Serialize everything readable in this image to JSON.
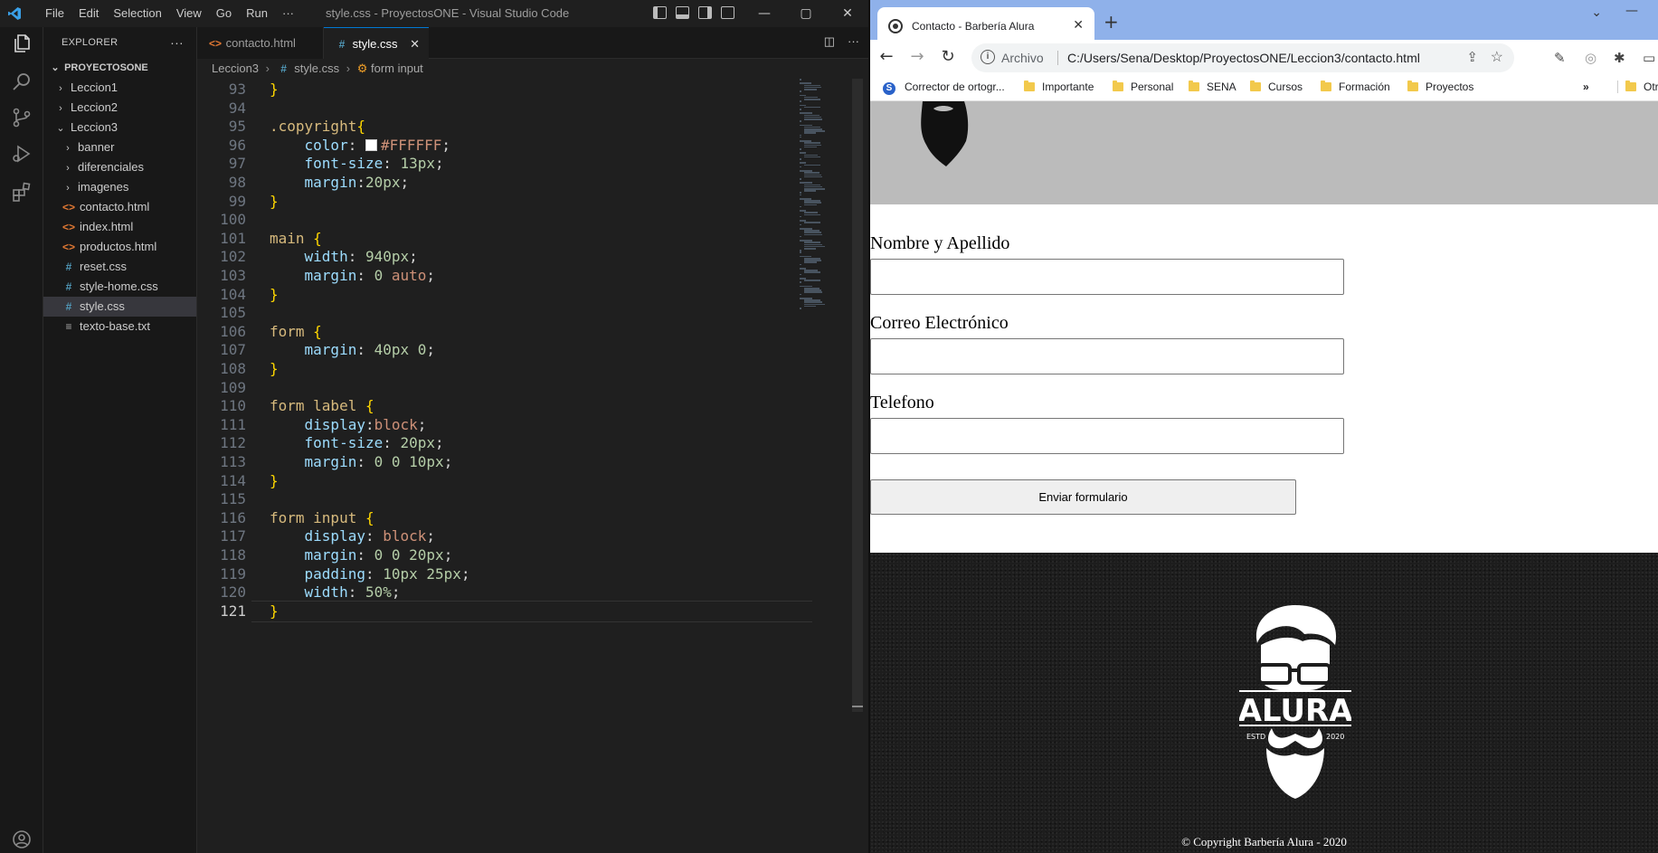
{
  "vscode": {
    "menu": [
      "File",
      "Edit",
      "Selection",
      "View",
      "Go",
      "Run",
      "···"
    ],
    "window_title": "style.css - ProyectosONE - Visual Studio Code",
    "window_controls": [
      "—",
      "▢",
      "✕"
    ],
    "explorer": {
      "header": "EXPLORER",
      "root": "PROYECTOSONE",
      "items": [
        {
          "label": "Leccion1",
          "type": "folder",
          "expanded": false,
          "depth": 1
        },
        {
          "label": "Leccion2",
          "type": "folder",
          "expanded": false,
          "depth": 1
        },
        {
          "label": "Leccion3",
          "type": "folder",
          "expanded": true,
          "depth": 1
        },
        {
          "label": "banner",
          "type": "folder",
          "expanded": false,
          "depth": 2
        },
        {
          "label": "diferenciales",
          "type": "folder",
          "expanded": false,
          "depth": 2
        },
        {
          "label": "imagenes",
          "type": "folder",
          "expanded": false,
          "depth": 2
        },
        {
          "label": "contacto.html",
          "type": "html",
          "depth": 2
        },
        {
          "label": "index.html",
          "type": "html",
          "depth": 2
        },
        {
          "label": "productos.html",
          "type": "html",
          "depth": 2
        },
        {
          "label": "reset.css",
          "type": "css",
          "depth": 2
        },
        {
          "label": "style-home.css",
          "type": "css",
          "depth": 2
        },
        {
          "label": "style.css",
          "type": "css",
          "depth": 2,
          "selected": true
        },
        {
          "label": "texto-base.txt",
          "type": "txt",
          "depth": 2
        }
      ]
    },
    "tabs": [
      {
        "label": "contacto.html",
        "active": false
      },
      {
        "label": "style.css",
        "active": true
      }
    ],
    "breadcrumb": [
      "Leccion3",
      "style.css",
      "form input"
    ],
    "current_line": 121,
    "code": [
      {
        "n": 93,
        "text": "}"
      },
      {
        "n": 94,
        "text": ""
      },
      {
        "n": 95,
        "text": ".copyright{"
      },
      {
        "n": 96,
        "text": "    color: #FFFFFF;"
      },
      {
        "n": 97,
        "text": "    font-size: 13px;"
      },
      {
        "n": 98,
        "text": "    margin:20px;"
      },
      {
        "n": 99,
        "text": "}"
      },
      {
        "n": 100,
        "text": ""
      },
      {
        "n": 101,
        "text": "main {"
      },
      {
        "n": 102,
        "text": "    width: 940px;"
      },
      {
        "n": 103,
        "text": "    margin: 0 auto;"
      },
      {
        "n": 104,
        "text": "}"
      },
      {
        "n": 105,
        "text": ""
      },
      {
        "n": 106,
        "text": "form {"
      },
      {
        "n": 107,
        "text": "    margin: 40px 0;"
      },
      {
        "n": 108,
        "text": "}"
      },
      {
        "n": 109,
        "text": ""
      },
      {
        "n": 110,
        "text": "form label {"
      },
      {
        "n": 111,
        "text": "    display:block;"
      },
      {
        "n": 112,
        "text": "    font-size: 20px;"
      },
      {
        "n": 113,
        "text": "    margin: 0 0 10px;"
      },
      {
        "n": 114,
        "text": "}"
      },
      {
        "n": 115,
        "text": ""
      },
      {
        "n": 116,
        "text": "form input {"
      },
      {
        "n": 117,
        "text": "    display: block;"
      },
      {
        "n": 118,
        "text": "    margin: 0 0 20px;"
      },
      {
        "n": 119,
        "text": "    padding: 10px 25px;"
      },
      {
        "n": 120,
        "text": "    width: 50%;"
      },
      {
        "n": 121,
        "text": "}"
      }
    ],
    "colors": {
      "selector": "#d7ba7d",
      "property": "#9cdcfe",
      "number": "#b5cea8",
      "keyword": "#ce9178",
      "bracket": "#ffd700"
    }
  },
  "chrome": {
    "tab_title": "Contacto - Barbería Alura",
    "address": {
      "security_label": "Archivo",
      "url": "C:/Users/Sena/Desktop/ProyectosONE/Leccion3/contacto.html"
    },
    "bookmarks": [
      {
        "label": "Corrector de ortogr...",
        "icon": "s-icon"
      },
      {
        "label": "Importante",
        "icon": "folder-icon"
      },
      {
        "label": "Personal",
        "icon": "folder-icon"
      },
      {
        "label": "SENA",
        "icon": "folder-icon"
      },
      {
        "label": "Cursos",
        "icon": "folder-icon"
      },
      {
        "label": "Formación",
        "icon": "folder-icon"
      },
      {
        "label": "Proyectos",
        "icon": "folder-icon"
      },
      {
        "label": "»",
        "icon": ""
      },
      {
        "label": "Otro",
        "icon": "folder-icon"
      }
    ],
    "page": {
      "form": {
        "labels": [
          "Nombre y Apellido",
          "Correo Electrónico",
          "Telefono"
        ],
        "values": [
          "",
          "",
          ""
        ],
        "submit_label": "Enviar formulario"
      },
      "footer": {
        "logo_text": "ALURA",
        "logo_estd": "ESTD",
        "logo_year": "2020",
        "copyright": "© Copyright Barbería Alura - 2020"
      },
      "colors": {
        "header_bg": "#bbbbbb",
        "footer_bg": "#1d1d1d"
      }
    }
  }
}
